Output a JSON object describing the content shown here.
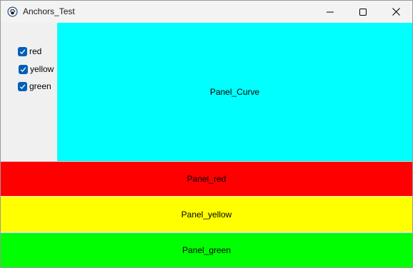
{
  "window": {
    "title": "Anchors_Test",
    "icon": "paw-icon",
    "controls": [
      "minimize-icon",
      "maximize-icon",
      "close-icon"
    ]
  },
  "checkboxes": [
    {
      "label": "red",
      "checked": true
    },
    {
      "label": "yellow",
      "checked": true
    },
    {
      "label": "green",
      "checked": true
    }
  ],
  "panels": {
    "curve": {
      "label": "Panel_Curve",
      "color": "#00ffff"
    },
    "red": {
      "label": "Panel_red",
      "color": "#ff0000"
    },
    "yellow": {
      "label": "Panel_yellow",
      "color": "#ffff00"
    },
    "green": {
      "label": "Panel_green",
      "color": "#00ff00"
    }
  },
  "colors": {
    "checkbox_accent": "#005fb8",
    "titlebar": "#f3f3f3",
    "client_background": "#f0f0f0"
  }
}
